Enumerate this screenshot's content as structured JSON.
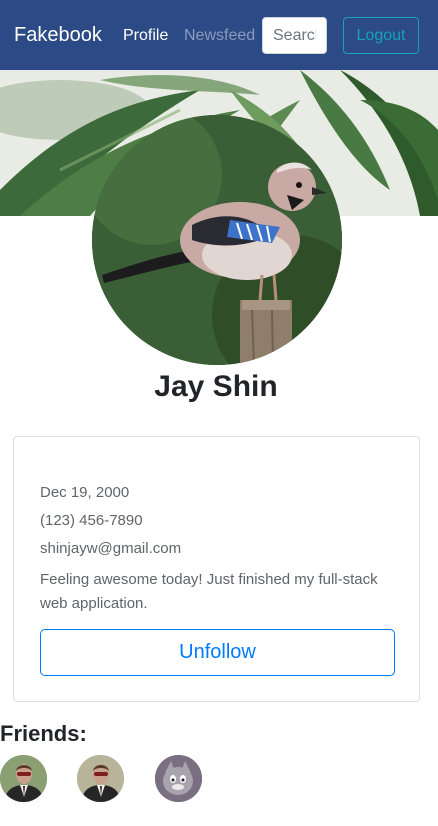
{
  "navbar": {
    "brand": "Fakebook",
    "links": [
      "Profile",
      "Newsfeed"
    ],
    "search_placeholder": "Search",
    "logout_label": "Logout"
  },
  "profile": {
    "name": "Jay Shin",
    "dob": "Dec 19, 2000",
    "phone": "(123) 456-7890",
    "email": "shinjayw@gmail.com",
    "status": "Feeling awesome today! Just finished my full-stack web application.",
    "unfollow_label": "Unfollow"
  },
  "friends": {
    "title": "Friends:"
  },
  "colors": {
    "navbar_bg": "#2c4a85",
    "logout_accent": "#17a2b8",
    "unfollow_accent": "#007bff"
  }
}
